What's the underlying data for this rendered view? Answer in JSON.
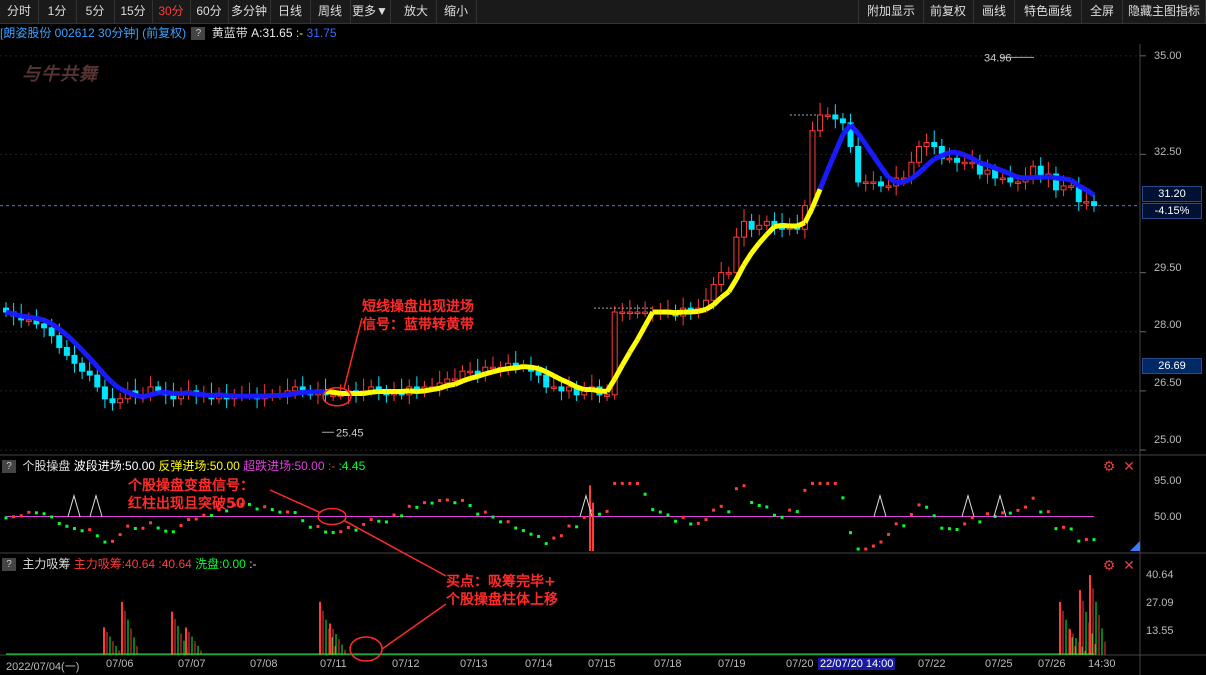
{
  "toolbar": {
    "left": [
      "分时",
      "1分",
      "5分",
      "15分",
      "30分",
      "60分",
      "多分钟",
      "日线",
      "周线",
      "更多▼",
      "放大",
      "缩小"
    ],
    "active_index": 4,
    "right": [
      "附加显示",
      "前复权",
      "画线",
      "特色画线",
      "全屏",
      "隐藏主图指标"
    ]
  },
  "info": {
    "stock": "[朗姿股份 002612 30分钟]",
    "adjust": "(前复权)",
    "q": "?",
    "indicator": "黄蓝带",
    "a_label": "A:31.65",
    "dash": ":-",
    "dash_val": "31.75"
  },
  "logo": "与牛共舞",
  "price_axis": [
    "35.00",
    "32.50",
    "31.20",
    "-4.15%",
    "29.50",
    "28.00",
    "26.69",
    "26.50",
    "25.00"
  ],
  "price_high": "34.96",
  "price_low": "25.45",
  "sub1": {
    "q": "?",
    "name": "个股操盘",
    "l1": "波段进场:50.00",
    "l2": "反弹进场:50.00",
    "l3": "超跌进场:50.00",
    "l4": ":-",
    "l5": ":4.45",
    "axis": [
      "95.00",
      "50.00"
    ]
  },
  "sub2": {
    "q": "?",
    "name": "主力吸筹",
    "l1": "主力吸筹:40.64",
    "l2": ":40.64",
    "l3": "洗盘:0.00",
    "l4": ":-",
    "axis": [
      "40.64",
      "27.09",
      "13.55"
    ]
  },
  "annotations": {
    "a1_line1": "短线操盘出现进场",
    "a1_line2": "信号：蓝带转黄带",
    "a2_line1": "个股操盘变盘信号：",
    "a2_line2": "红柱出现且突破50",
    "a3_line1": "买点：吸筹完毕+",
    "a3_line2": "个股操盘柱体上移"
  },
  "x_axis": [
    "2022/07/04(一)",
    "07/06",
    "07/07",
    "07/08",
    "07/11",
    "07/12",
    "07/13",
    "07/14",
    "07/15",
    "07/18",
    "07/19",
    "07/20",
    "22/07/20 14:00",
    "07/22",
    "07/25",
    "07/26",
    "14:30"
  ],
  "colors": {
    "up": "#ff3b3b",
    "down": "#00e5ff",
    "yellow": "#ffff00",
    "blue": "#1a1aff",
    "magenta": "#e040e0",
    "green": "#00ff33"
  },
  "chart_data": {
    "type": "candlestick",
    "interval": "30min",
    "ylim": [
      25.0,
      35.3
    ],
    "y_ticks": [
      25.0,
      26.5,
      28.0,
      29.5,
      32.5,
      35.0
    ],
    "last_close": 31.2,
    "pct_change": "-4.15%",
    "high_mark": 34.96,
    "low_mark": 25.45,
    "candles_close": [
      28.5,
      28.4,
      28.3,
      28.3,
      28.2,
      28.1,
      27.9,
      27.6,
      27.4,
      27.2,
      27.0,
      26.9,
      26.6,
      26.3,
      26.2,
      26.3,
      26.5,
      26.4,
      26.4,
      26.6,
      26.5,
      26.4,
      26.3,
      26.4,
      26.5,
      26.4,
      26.4,
      26.3,
      26.4,
      26.3,
      26.4,
      26.4,
      26.4,
      26.3,
      26.4,
      26.4,
      26.4,
      26.5,
      26.6,
      26.5,
      26.4,
      26.5,
      26.4,
      26.4,
      26.4,
      26.5,
      26.4,
      26.5,
      26.6,
      26.5,
      26.4,
      26.5,
      26.4,
      26.6,
      26.5,
      26.6,
      26.6,
      26.7,
      26.8,
      26.8,
      27.0,
      27.0,
      26.9,
      27.1,
      27.1,
      27.1,
      27.2,
      27.1,
      27.1,
      27.0,
      26.9,
      26.6,
      26.6,
      26.5,
      26.6,
      26.4,
      26.5,
      26.6,
      26.4,
      26.4,
      28.5,
      28.5,
      28.5,
      28.5,
      28.5,
      28.5,
      28.5,
      28.5,
      28.4,
      28.6,
      28.5,
      28.6,
      28.8,
      29.2,
      29.5,
      29.5,
      30.4,
      30.8,
      30.6,
      30.7,
      30.8,
      30.7,
      30.6,
      30.7,
      30.6,
      31.2,
      33.1,
      33.5,
      33.5,
      33.4,
      33.3,
      32.7,
      31.8,
      31.8,
      31.8,
      31.7,
      31.7,
      31.9,
      31.9,
      32.3,
      32.7,
      32.8,
      32.7,
      32.4,
      32.4,
      32.3,
      32.3,
      32.3,
      32.0,
      32.1,
      31.9,
      31.9,
      31.8,
      31.8,
      31.9,
      32.2,
      31.9,
      32.0,
      31.6,
      31.7,
      31.7,
      31.3,
      31.3,
      31.2
    ],
    "band_colors": "blue until 07/11 signal, yellow to 07/20, blue after",
    "sub1_ref_line": 50,
    "sub2_max": 40.64
  }
}
